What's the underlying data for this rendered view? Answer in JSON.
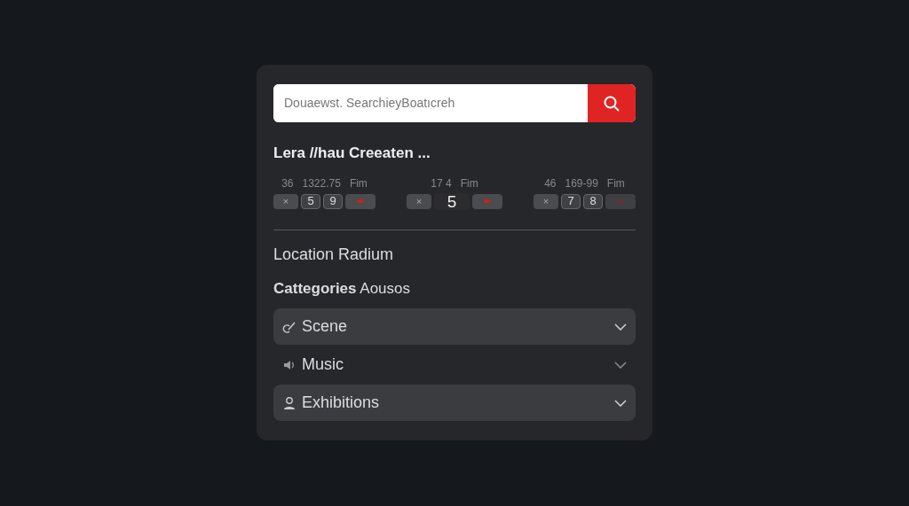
{
  "search": {
    "value": "Douaewst. SearchieyBoatıcreh"
  },
  "heading": "Lera //hau Creeaten ...",
  "groups": [
    {
      "labels": [
        "36",
        "1322.75",
        "Fim"
      ],
      "cells": [
        {
          "kind": "close",
          "text": "×"
        },
        {
          "kind": "digit",
          "text": "5"
        },
        {
          "kind": "digit",
          "text": "9"
        },
        {
          "kind": "dot"
        }
      ]
    },
    {
      "labels": [
        "17 4",
        "Fim"
      ],
      "cells": [
        {
          "kind": "close",
          "text": "×"
        },
        {
          "kind": "big",
          "text": "5"
        },
        {
          "kind": "dot"
        }
      ]
    },
    {
      "labels": [
        "46",
        "169-99",
        "Fim"
      ],
      "cells": [
        {
          "kind": "close",
          "text": "×"
        },
        {
          "kind": "digit",
          "text": "7"
        },
        {
          "kind": "digit",
          "text": "8"
        },
        {
          "kind": "faint-dot"
        }
      ]
    }
  ],
  "location_label": "Location Radium",
  "categories_label": "**Cattegories** Aousos",
  "categories": [
    {
      "label": "Scene",
      "kind": "brush",
      "highlighted": true
    },
    {
      "label": "Music",
      "kind": "speaker",
      "highlighted": false
    },
    {
      "label": "Exhibitions",
      "kind": "person",
      "highlighted": true
    }
  ]
}
